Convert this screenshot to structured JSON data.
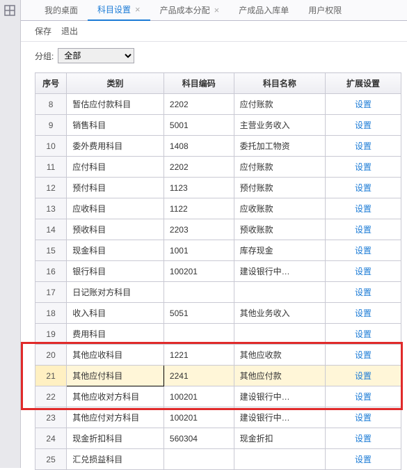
{
  "tabs": {
    "t0": "我的桌面",
    "t1": "科目设置",
    "t2": "产品成本分配",
    "t3": "产成品入库单",
    "t4": "用户权限"
  },
  "close_glyph": "×",
  "toolbar": {
    "save": "保存",
    "quit": "退出"
  },
  "filter": {
    "label": "分组:",
    "value": "全部"
  },
  "headers": {
    "h1": "序号",
    "h2": "类别",
    "h3": "科目编码",
    "h4": "科目名称",
    "h5": "扩展设置"
  },
  "link_label": "设置",
  "rows": [
    {
      "seq": "8",
      "cat": "暂估应付款科目",
      "code": "2202",
      "name": "应付账款"
    },
    {
      "seq": "9",
      "cat": "销售科目",
      "code": "5001",
      "name": "主营业务收入"
    },
    {
      "seq": "10",
      "cat": "委外费用科目",
      "code": "1408",
      "name": "委托加工物资"
    },
    {
      "seq": "11",
      "cat": "应付科目",
      "code": "2202",
      "name": "应付账款"
    },
    {
      "seq": "12",
      "cat": "预付科目",
      "code": "1123",
      "name": "预付账款"
    },
    {
      "seq": "13",
      "cat": "应收科目",
      "code": "1122",
      "name": "应收账款"
    },
    {
      "seq": "14",
      "cat": "预收科目",
      "code": "2203",
      "name": "预收账款"
    },
    {
      "seq": "15",
      "cat": "现金科目",
      "code": "1001",
      "name": "库存现金"
    },
    {
      "seq": "16",
      "cat": "银行科目",
      "code": "100201",
      "name": "建设银行中…"
    },
    {
      "seq": "17",
      "cat": "日记账对方科目",
      "code": "",
      "name": ""
    },
    {
      "seq": "18",
      "cat": "收入科目",
      "code": "5051",
      "name": "其他业务收入"
    },
    {
      "seq": "19",
      "cat": "费用科目",
      "code": "",
      "name": ""
    },
    {
      "seq": "20",
      "cat": "其他应收科目",
      "code": "1221",
      "name": "其他应收款"
    },
    {
      "seq": "21",
      "cat": "其他应付科目",
      "code": "2241",
      "name": "其他应付款",
      "selected": true
    },
    {
      "seq": "22",
      "cat": "其他应收对方科目",
      "code": "100201",
      "name": "建设银行中…"
    },
    {
      "seq": "23",
      "cat": "其他应付对方科目",
      "code": "100201",
      "name": "建设银行中…"
    },
    {
      "seq": "24",
      "cat": "现金折扣科目",
      "code": "560304",
      "name": "现金折扣"
    },
    {
      "seq": "25",
      "cat": "汇兑损益科目",
      "code": "",
      "name": ""
    }
  ],
  "highlight_rows": [
    12,
    13,
    14
  ]
}
